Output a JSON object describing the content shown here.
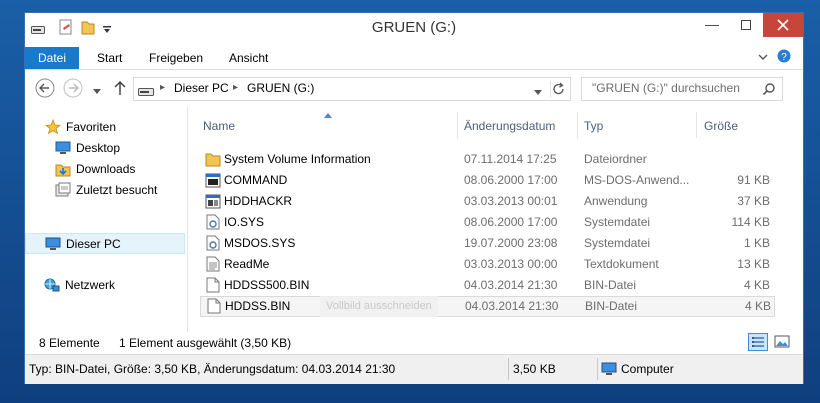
{
  "window": {
    "title": "GRUEN (G:)"
  },
  "ribbon": {
    "tabs": [
      {
        "label": "Datei",
        "active": true
      },
      {
        "label": "Start"
      },
      {
        "label": "Freigeben"
      },
      {
        "label": "Ansicht"
      }
    ]
  },
  "address": {
    "crumbs": [
      "Dieser PC",
      "GRUEN (G:)"
    ],
    "search_placeholder": "\"GRUEN (G:)\" durchsuchen"
  },
  "nav": {
    "favorites_label": "Favoriten",
    "items": [
      {
        "label": "Desktop"
      },
      {
        "label": "Downloads"
      },
      {
        "label": "Zuletzt besucht"
      }
    ],
    "pc_label": "Dieser PC",
    "network_label": "Netzwerk"
  },
  "columns": [
    {
      "label": "Name"
    },
    {
      "label": "Änderungsdatum"
    },
    {
      "label": "Typ"
    },
    {
      "label": "Größe"
    }
  ],
  "files": [
    {
      "name": "System Volume Information",
      "date": "07.11.2014 17:25",
      "type": "Dateiordner",
      "size": ""
    },
    {
      "name": "COMMAND",
      "date": "08.06.2000 17:00",
      "type": "MS-DOS-Anwend...",
      "size": "91 KB"
    },
    {
      "name": "HDDHACKR",
      "date": "03.03.2013 00:01",
      "type": "Anwendung",
      "size": "37 KB"
    },
    {
      "name": "IO.SYS",
      "date": "08.06.2000 17:00",
      "type": "Systemdatei",
      "size": "114 KB"
    },
    {
      "name": "MSDOS.SYS",
      "date": "19.07.2000 23:08",
      "type": "Systemdatei",
      "size": "1 KB"
    },
    {
      "name": "ReadMe",
      "date": "03.03.2013 00:00",
      "type": "Textdokument",
      "size": "13 KB"
    },
    {
      "name": "HDDSS500.BIN",
      "date": "04.03.2014 21:30",
      "type": "BIN-Datei",
      "size": "4 KB"
    },
    {
      "name": "HDDSS.BIN",
      "date": "04.03.2014 21:30",
      "type": "BIN-Datei",
      "size": "4 KB",
      "selected": true
    }
  ],
  "tooltip_ghost": "Vollbild ausschneiden",
  "status": {
    "count": "8 Elemente",
    "selection": "1 Element ausgewählt (3,50 KB)"
  },
  "details": {
    "info": "Typ: BIN-Datei, Größe: 3,50 KB, Änderungsdatum: 04.03.2014 21:30",
    "size": "3,50 KB",
    "location": "Computer"
  }
}
